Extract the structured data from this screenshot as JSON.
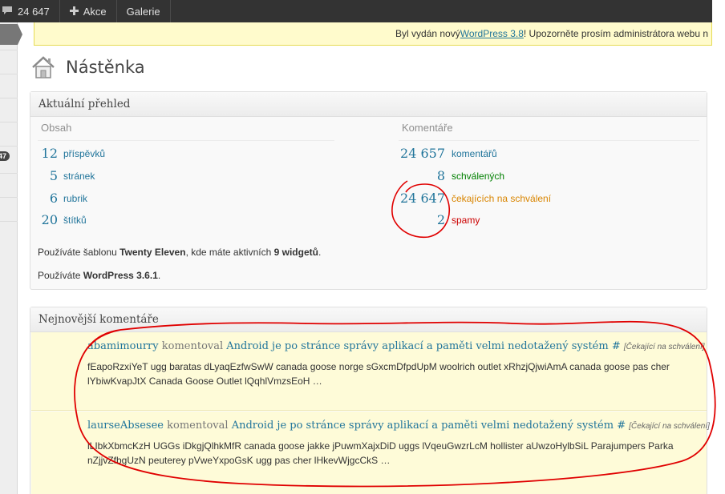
{
  "adminbar": {
    "comments_count": "24 647",
    "new_label": "Akce",
    "gallery_label": "Galerie"
  },
  "leftmenu": {
    "badge": "47"
  },
  "nag": {
    "before": "Byl vydán nový ",
    "link": "WordPress 3.8",
    "after": "! Upozorněte prosím administrátora webu n"
  },
  "page": {
    "title": "Nástěnka"
  },
  "right_now": {
    "title": "Aktuální přehled",
    "content_head": "Obsah",
    "discussion_head": "Komentáře",
    "content": [
      {
        "num": "12",
        "label": "příspěvků"
      },
      {
        "num": "5",
        "label": "stránek"
      },
      {
        "num": "6",
        "label": "rubrik"
      },
      {
        "num": "20",
        "label": "štítků"
      }
    ],
    "discussion": [
      {
        "num": "24 657",
        "label": "komentářů"
      },
      {
        "num": "8",
        "label": "schválených"
      },
      {
        "num": "24 647",
        "label": "čekajících na schválení"
      },
      {
        "num": "2",
        "label": "spamy"
      }
    ],
    "theme_line": {
      "p1": "Používáte šablonu ",
      "theme": "Twenty Eleven",
      "p2": ", kde máte aktivních ",
      "widgets": "9 widgetů",
      "p3": "."
    },
    "version_line": {
      "p1": "Používáte ",
      "version": "WordPress 3.6.1",
      "p2": "."
    }
  },
  "recent_comments": {
    "title": "Nejnovější komentáře",
    "items": [
      {
        "author": "abamimourry",
        "verb": "komentoval",
        "post": "Android je po stránce správy aplikací a paměti velmi nedotažený systém",
        "hash": "#",
        "status": "[Čekající na schválení]",
        "excerpt": "fEapoRzxiYeT ugg baratas dLyaqEzfwSwW canada goose norge sGxcmDfpdUpM woolrich outlet xRhzjQjwiAmA canada goose pas cher lYbiwKvapJtX Canada Goose Outlet lQqhlVmzsEoH …"
      },
      {
        "author": "laurseAbsesee",
        "verb": "komentoval",
        "post": "Android je po stránce správy aplikací a paměti velmi nedotažený systém",
        "hash": "#",
        "status": "[Čekající na schválení]",
        "excerpt": "lLIbkXbmcKzH UGGs iDkgjQlhkMfR canada goose jakke jPuwmXajxDiD uggs lVqeuGwzrLcM hollister aUwzoHylbSiL Parajumpers Parka nZjjvZfbgUzN peuterey pVweYxpoGsK ugg pas cher lHkevWjgcCkS …"
      }
    ]
  },
  "colors": {
    "link": "#21759b",
    "approved": "#008000",
    "pending": "#d98500",
    "spam": "#cc0000",
    "annotation": "#e00000"
  }
}
